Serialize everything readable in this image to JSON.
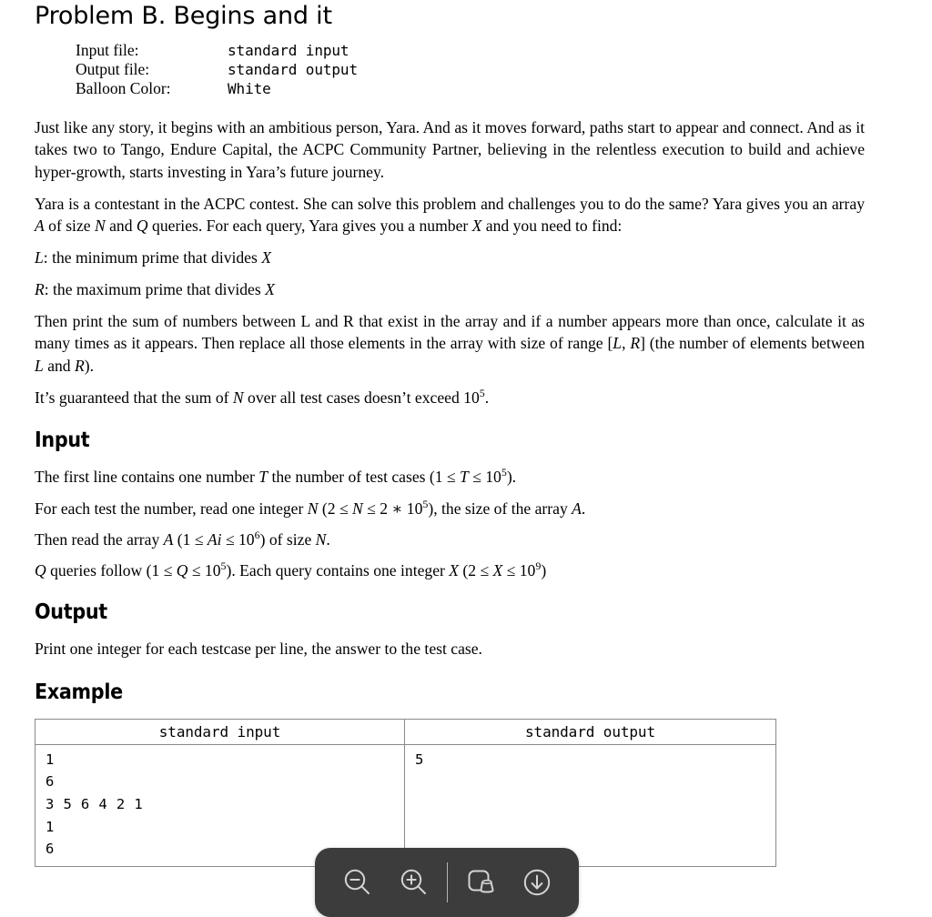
{
  "document": {
    "title": "Problem B. Begins and it",
    "meta": [
      {
        "label": "Input file:",
        "value": "standard input"
      },
      {
        "label": "Output file:",
        "value": "standard output"
      },
      {
        "label": "Balloon Color:",
        "value": "White"
      }
    ],
    "statement": {
      "p1": "Just like any story, it begins with an ambitious person, Yara. And as it moves forward, paths start to appear and connect. And as it takes two to Tango, Endure Capital, the ACPC Community Partner, believing in the relentless execution to build and achieve hyper-growth, starts investing in Yara’s future journey.",
      "p2_a": "Yara is a contestant in the ACPC contest. She can solve this problem and challenges you to do the same? Yara gives you an array ",
      "p2_A": "A",
      "p2_b": " of size ",
      "p2_N": "N",
      "p2_c": " and ",
      "p2_Q": "Q",
      "p2_d": " queries. For each query, Yara gives you a number ",
      "p2_X": "X",
      "p2_e": " and you need to find:",
      "lineL_var": "L",
      "lineL_text": ": the minimum prime that divides ",
      "lineL_X": "X",
      "lineR_var": "R",
      "lineR_text": ": the maximum prime that divides ",
      "lineR_X": "X",
      "p3_a": "Then print the sum of numbers between L and R that exist in the array and if a number appears more than once, calculate it as many times as it appears. Then replace all those elements in the array with size of range [",
      "p3_L": "L",
      "p3_comma": ", ",
      "p3_R": "R",
      "p3_b": "] (the number of elements between ",
      "p3_L2": "L",
      "p3_and": " and ",
      "p3_R2": "R",
      "p3_c": ").",
      "p4_a": "It’s guaranteed that the sum of ",
      "p4_N": "N",
      "p4_b": " over all test cases doesn’t exceed 10",
      "p4_exp": "5",
      "p4_c": "."
    },
    "sections": {
      "input_heading": "Input",
      "output_heading": "Output",
      "example_heading": "Example"
    },
    "input_spec": {
      "l1_a": "The first line contains one number ",
      "l1_T": "T",
      "l1_b": " the number of test cases (1 ≤ ",
      "l1_T2": "T",
      "l1_c": " ≤ 10",
      "l1_exp": "5",
      "l1_d": ").",
      "l2_a": "For each test the number, read one integer ",
      "l2_N": "N",
      "l2_b": " (2 ≤ ",
      "l2_N2": "N",
      "l2_c": " ≤ 2 ∗ 10",
      "l2_exp": "5",
      "l2_d": "), the size of the array ",
      "l2_A": "A",
      "l2_e": ".",
      "l3_a": "Then read the array ",
      "l3_A": "A",
      "l3_b": " (1 ≤ ",
      "l3_Ai": "Ai",
      "l3_c": " ≤ 10",
      "l3_exp": "6",
      "l3_d": ") of size ",
      "l3_N": "N",
      "l3_e": ".",
      "l4_Q": "Q",
      "l4_a": " queries follow (1 ≤ ",
      "l4_Q2": "Q",
      "l4_b": " ≤ 10",
      "l4_exp": "5",
      "l4_c": "). Each query contains one integer ",
      "l4_X": "X",
      "l4_d": " (2 ≤ ",
      "l4_X2": "X",
      "l4_e": " ≤ 10",
      "l4_exp2": "9",
      "l4_f": ")"
    },
    "output_spec": {
      "line": "Print one integer for each testcase per line, the answer to the test case."
    },
    "example": {
      "headers": [
        "standard input",
        "standard output"
      ],
      "rows": [
        {
          "input": "1\n6\n3 5 6 4 2 1\n1\n6",
          "output": "5"
        }
      ]
    }
  },
  "pdf_toolbar": {
    "background_color": "#3c3c3c",
    "icon_color": "#d4d4d4",
    "buttons": [
      {
        "name": "zoom-out-icon",
        "label": "Zoom out"
      },
      {
        "name": "zoom-in-icon",
        "label": "Zoom in"
      },
      {
        "name": "annotate-icon",
        "label": "Annotate"
      },
      {
        "name": "download-icon",
        "label": "Download"
      }
    ]
  }
}
